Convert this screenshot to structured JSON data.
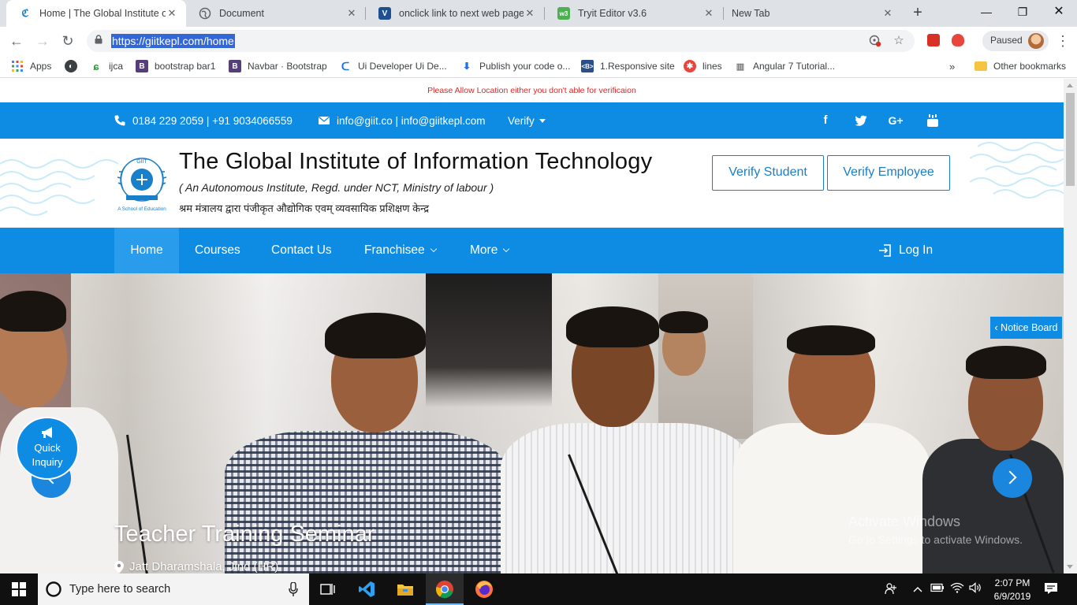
{
  "browser": {
    "tabs": [
      {
        "title": "Home | The Global Institute of",
        "favicon": "giit-favicon"
      },
      {
        "title": "Document",
        "favicon": "globe-icon"
      },
      {
        "title": "onclick link to next web page -",
        "favicon": "site-favicon"
      },
      {
        "title": "Tryit Editor v3.6",
        "favicon": "w3schools-favicon"
      },
      {
        "title": "New Tab",
        "favicon": ""
      }
    ],
    "url": "https://giitkepl.com/home",
    "profile_status": "Paused",
    "bookmarks": [
      {
        "label": "Apps",
        "icon": "apps-grid-icon"
      },
      {
        "label": "",
        "icon": "globe-icon"
      },
      {
        "label": "ijca",
        "icon": "leaf-icon"
      },
      {
        "label": "bootstrap bar1",
        "icon": "bootstrap-icon"
      },
      {
        "label": "Navbar · Bootstrap",
        "icon": "bootstrap-icon"
      },
      {
        "label": "Ui Developer Ui De...",
        "icon": "site-icon"
      },
      {
        "label": "Publish your code o...",
        "icon": "stackoverflow-icon"
      },
      {
        "label": "1.Responsive site",
        "icon": "blogger-icon"
      },
      {
        "label": "lines",
        "icon": "star-badge-icon"
      },
      {
        "label": "Angular 7 Tutorial...",
        "icon": "site-icon"
      }
    ],
    "overflow_chevron": "»",
    "other_bookmarks": "Other bookmarks"
  },
  "page": {
    "location_notice": "Please Allow Location either you don't able for verificaion",
    "topbar": {
      "phone": "0184 229 2059 | +91 9034066559",
      "email": "info@giit.co | info@giitkepl.com",
      "verify": "Verify",
      "social": [
        "facebook-icon",
        "twitter-icon",
        "google-plus-icon",
        "youtube-icon"
      ],
      "social_glyphs": [
        "f",
        "t",
        "G+",
        "▶"
      ]
    },
    "header": {
      "title": "The Global Institute of Information Technology",
      "subtitle": "( An Autonomous Institute, Regd. under NCT, Ministry of labour )",
      "hindi": "श्रम मंत्रालय द्वारा पंजीकृत   औद्योगिक एवम् व्यवसायिक प्रशिक्षण केन्द्र",
      "logo_text": "GIIT",
      "logo_tagline": "A School of Education",
      "verify_student": "Verify Student",
      "verify_employee": "Verify Employee"
    },
    "nav": {
      "items": [
        "Home",
        "Courses",
        "Contact Us",
        "Franchisee",
        "More"
      ],
      "login": "Log In"
    },
    "slider": {
      "notice_board": "‹ Notice Board",
      "caption_title": "Teacher Training Seminar",
      "caption_place": "Jatt Dharamshala, Jind (HR)",
      "quick_inquiry_line1": "Quick",
      "quick_inquiry_line2": "Inquiry"
    },
    "watermark": {
      "line1": "Activate Windows",
      "line2": "Go to Settings to activate Windows."
    }
  },
  "taskbar": {
    "search_placeholder": "Type here to search",
    "time": "2:07 PM",
    "date": "6/9/2019"
  },
  "colors": {
    "brand_blue": "#0e8ce4",
    "nav_active": "#2a9cec",
    "notice_red": "#e02424",
    "url_highlight": "#3367d6"
  }
}
